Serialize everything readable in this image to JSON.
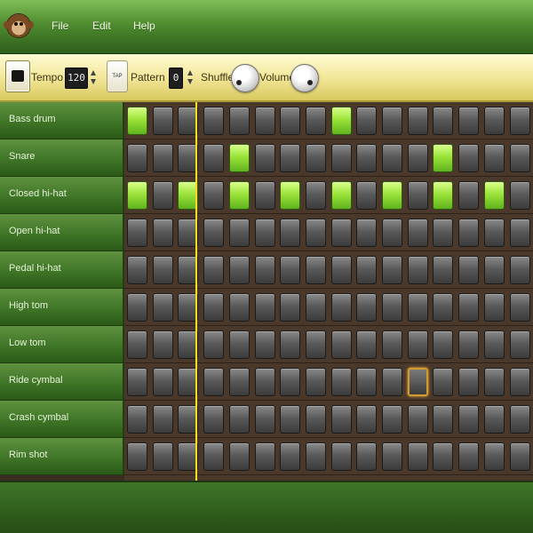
{
  "menubar": {
    "logo": "monkey-icon",
    "items": [
      "File",
      "Edit",
      "Help"
    ]
  },
  "toolbar": {
    "play_icon": "stop-icon",
    "tempo_label": "Tempo",
    "tempo_value": "120",
    "tap_label": "TAP",
    "pattern_label": "Pattern",
    "pattern_value": "0",
    "shuffle_label": "Shuffle",
    "volume_label": "Volume"
  },
  "instruments": [
    "Bass drum",
    "Snare",
    "Closed hi-hat",
    "Open hi-hat",
    "Pedal hi-hat",
    "High tom",
    "Low tom",
    "Ride cymbal",
    "Crash cymbal",
    "Rim shot"
  ],
  "steps": 16,
  "active_steps": {
    "Bass drum": [
      0,
      8
    ],
    "Snare": [
      4,
      12
    ],
    "Closed hi-hat": [
      0,
      2,
      4,
      6,
      8,
      10,
      12,
      14
    ]
  },
  "selected_cell": {
    "instrument": "Ride cymbal",
    "step": 11
  },
  "playhead_step": 3,
  "colors": {
    "active_step": "#9be33a",
    "playhead": "#ffde1e",
    "selected_outline": "#d39b2a",
    "lane_green": "#3f7527"
  }
}
